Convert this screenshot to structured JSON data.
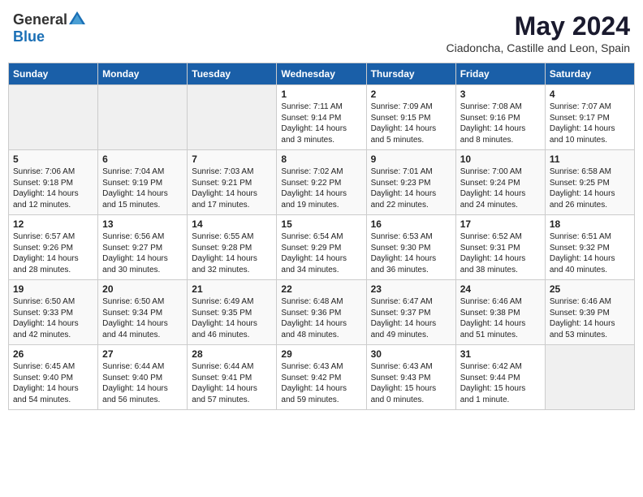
{
  "header": {
    "logo_general": "General",
    "logo_blue": "Blue",
    "month": "May 2024",
    "location": "Ciadoncha, Castille and Leon, Spain"
  },
  "weekdays": [
    "Sunday",
    "Monday",
    "Tuesday",
    "Wednesday",
    "Thursday",
    "Friday",
    "Saturday"
  ],
  "weeks": [
    [
      {
        "day": "",
        "sunrise": "",
        "sunset": "",
        "daylight": ""
      },
      {
        "day": "",
        "sunrise": "",
        "sunset": "",
        "daylight": ""
      },
      {
        "day": "",
        "sunrise": "",
        "sunset": "",
        "daylight": ""
      },
      {
        "day": "1",
        "sunrise": "Sunrise: 7:11 AM",
        "sunset": "Sunset: 9:14 PM",
        "daylight": "Daylight: 14 hours and 3 minutes."
      },
      {
        "day": "2",
        "sunrise": "Sunrise: 7:09 AM",
        "sunset": "Sunset: 9:15 PM",
        "daylight": "Daylight: 14 hours and 5 minutes."
      },
      {
        "day": "3",
        "sunrise": "Sunrise: 7:08 AM",
        "sunset": "Sunset: 9:16 PM",
        "daylight": "Daylight: 14 hours and 8 minutes."
      },
      {
        "day": "4",
        "sunrise": "Sunrise: 7:07 AM",
        "sunset": "Sunset: 9:17 PM",
        "daylight": "Daylight: 14 hours and 10 minutes."
      }
    ],
    [
      {
        "day": "5",
        "sunrise": "Sunrise: 7:06 AM",
        "sunset": "Sunset: 9:18 PM",
        "daylight": "Daylight: 14 hours and 12 minutes."
      },
      {
        "day": "6",
        "sunrise": "Sunrise: 7:04 AM",
        "sunset": "Sunset: 9:19 PM",
        "daylight": "Daylight: 14 hours and 15 minutes."
      },
      {
        "day": "7",
        "sunrise": "Sunrise: 7:03 AM",
        "sunset": "Sunset: 9:21 PM",
        "daylight": "Daylight: 14 hours and 17 minutes."
      },
      {
        "day": "8",
        "sunrise": "Sunrise: 7:02 AM",
        "sunset": "Sunset: 9:22 PM",
        "daylight": "Daylight: 14 hours and 19 minutes."
      },
      {
        "day": "9",
        "sunrise": "Sunrise: 7:01 AM",
        "sunset": "Sunset: 9:23 PM",
        "daylight": "Daylight: 14 hours and 22 minutes."
      },
      {
        "day": "10",
        "sunrise": "Sunrise: 7:00 AM",
        "sunset": "Sunset: 9:24 PM",
        "daylight": "Daylight: 14 hours and 24 minutes."
      },
      {
        "day": "11",
        "sunrise": "Sunrise: 6:58 AM",
        "sunset": "Sunset: 9:25 PM",
        "daylight": "Daylight: 14 hours and 26 minutes."
      }
    ],
    [
      {
        "day": "12",
        "sunrise": "Sunrise: 6:57 AM",
        "sunset": "Sunset: 9:26 PM",
        "daylight": "Daylight: 14 hours and 28 minutes."
      },
      {
        "day": "13",
        "sunrise": "Sunrise: 6:56 AM",
        "sunset": "Sunset: 9:27 PM",
        "daylight": "Daylight: 14 hours and 30 minutes."
      },
      {
        "day": "14",
        "sunrise": "Sunrise: 6:55 AM",
        "sunset": "Sunset: 9:28 PM",
        "daylight": "Daylight: 14 hours and 32 minutes."
      },
      {
        "day": "15",
        "sunrise": "Sunrise: 6:54 AM",
        "sunset": "Sunset: 9:29 PM",
        "daylight": "Daylight: 14 hours and 34 minutes."
      },
      {
        "day": "16",
        "sunrise": "Sunrise: 6:53 AM",
        "sunset": "Sunset: 9:30 PM",
        "daylight": "Daylight: 14 hours and 36 minutes."
      },
      {
        "day": "17",
        "sunrise": "Sunrise: 6:52 AM",
        "sunset": "Sunset: 9:31 PM",
        "daylight": "Daylight: 14 hours and 38 minutes."
      },
      {
        "day": "18",
        "sunrise": "Sunrise: 6:51 AM",
        "sunset": "Sunset: 9:32 PM",
        "daylight": "Daylight: 14 hours and 40 minutes."
      }
    ],
    [
      {
        "day": "19",
        "sunrise": "Sunrise: 6:50 AM",
        "sunset": "Sunset: 9:33 PM",
        "daylight": "Daylight: 14 hours and 42 minutes."
      },
      {
        "day": "20",
        "sunrise": "Sunrise: 6:50 AM",
        "sunset": "Sunset: 9:34 PM",
        "daylight": "Daylight: 14 hours and 44 minutes."
      },
      {
        "day": "21",
        "sunrise": "Sunrise: 6:49 AM",
        "sunset": "Sunset: 9:35 PM",
        "daylight": "Daylight: 14 hours and 46 minutes."
      },
      {
        "day": "22",
        "sunrise": "Sunrise: 6:48 AM",
        "sunset": "Sunset: 9:36 PM",
        "daylight": "Daylight: 14 hours and 48 minutes."
      },
      {
        "day": "23",
        "sunrise": "Sunrise: 6:47 AM",
        "sunset": "Sunset: 9:37 PM",
        "daylight": "Daylight: 14 hours and 49 minutes."
      },
      {
        "day": "24",
        "sunrise": "Sunrise: 6:46 AM",
        "sunset": "Sunset: 9:38 PM",
        "daylight": "Daylight: 14 hours and 51 minutes."
      },
      {
        "day": "25",
        "sunrise": "Sunrise: 6:46 AM",
        "sunset": "Sunset: 9:39 PM",
        "daylight": "Daylight: 14 hours and 53 minutes."
      }
    ],
    [
      {
        "day": "26",
        "sunrise": "Sunrise: 6:45 AM",
        "sunset": "Sunset: 9:40 PM",
        "daylight": "Daylight: 14 hours and 54 minutes."
      },
      {
        "day": "27",
        "sunrise": "Sunrise: 6:44 AM",
        "sunset": "Sunset: 9:40 PM",
        "daylight": "Daylight: 14 hours and 56 minutes."
      },
      {
        "day": "28",
        "sunrise": "Sunrise: 6:44 AM",
        "sunset": "Sunset: 9:41 PM",
        "daylight": "Daylight: 14 hours and 57 minutes."
      },
      {
        "day": "29",
        "sunrise": "Sunrise: 6:43 AM",
        "sunset": "Sunset: 9:42 PM",
        "daylight": "Daylight: 14 hours and 59 minutes."
      },
      {
        "day": "30",
        "sunrise": "Sunrise: 6:43 AM",
        "sunset": "Sunset: 9:43 PM",
        "daylight": "Daylight: 15 hours and 0 minutes."
      },
      {
        "day": "31",
        "sunrise": "Sunrise: 6:42 AM",
        "sunset": "Sunset: 9:44 PM",
        "daylight": "Daylight: 15 hours and 1 minute."
      },
      {
        "day": "",
        "sunrise": "",
        "sunset": "",
        "daylight": ""
      }
    ]
  ]
}
